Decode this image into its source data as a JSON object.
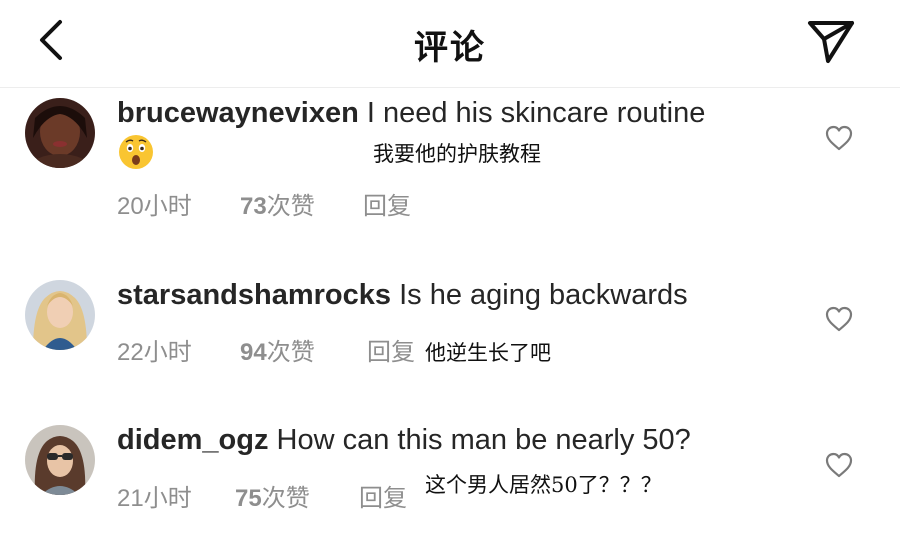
{
  "header": {
    "title": "评论",
    "back_icon": "chevron-left-icon",
    "send_icon": "paper-plane-icon"
  },
  "comments": [
    {
      "username": "brucewaynevixen",
      "text": "I need his skincare routine",
      "emoji": "😲",
      "translation": "我要他的护肤教程",
      "time": "20小时",
      "likes_count": "73",
      "likes_label": "次赞",
      "reply": "回复"
    },
    {
      "username": "starsandshamrocks",
      "text": "Is he aging backwards",
      "translation": "他逆生长了吧",
      "time": "22小时",
      "likes_count": "94",
      "likes_label": "次赞",
      "reply": "回复"
    },
    {
      "username": "didem_ogz",
      "text": "How can this man be nearly 50?",
      "translation": "这个男人居然50了？？？",
      "time": "21小时",
      "likes_count": "75",
      "likes_label": "次赞",
      "reply": "回复"
    }
  ],
  "colors": {
    "text": "#262626",
    "meta": "#8e8e8e",
    "divider": "#ededed",
    "emoji_face": "#f9c531"
  }
}
